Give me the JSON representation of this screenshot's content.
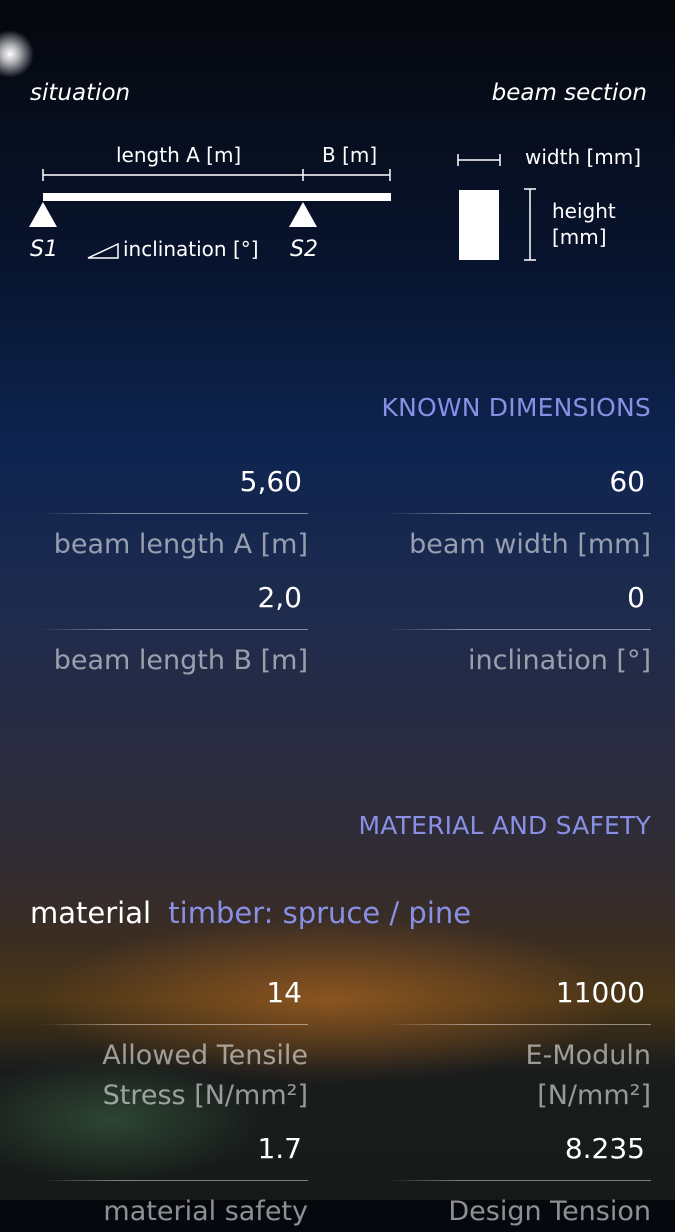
{
  "diagram": {
    "situation_title": "situation",
    "beam_section_title": "beam section",
    "length_a_label": "length A [m]",
    "length_b_label": "B [m]",
    "support_1": "S1",
    "support_2": "S2",
    "inclination_label": "inclination [°]",
    "width_label": "width [mm]",
    "height_label_line1": "height",
    "height_label_line2": "[mm]"
  },
  "known_dimensions": {
    "title": "KNOWN DIMENSIONS",
    "beam_length_a": {
      "value": "5,60",
      "label": "beam length A [m]"
    },
    "beam_width": {
      "value": "60",
      "label": "beam width [mm]"
    },
    "beam_length_b": {
      "value": "2,0",
      "label": "beam length B [m]"
    },
    "inclination": {
      "value": "0",
      "label": "inclination [°]"
    }
  },
  "material_safety": {
    "title": "MATERIAL AND SAFETY",
    "material_label": "material",
    "material_value": "timber: spruce / pine",
    "tensile_stress": {
      "value": "14",
      "label_line1": "Allowed Tensile",
      "label_line2": "Stress [N/mm²]"
    },
    "e_modulus": {
      "value": "11000",
      "label_line1": "E-Moduln",
      "label_line2": "[N/mm²]"
    },
    "material_safety": {
      "value": "1.7",
      "label_line1": "material safety"
    },
    "design_tension": {
      "value": "8.235",
      "label_line1": "Design Tension"
    }
  },
  "colors": {
    "accent": "#8a8fe6",
    "text": "#ffffff",
    "muted_text": "rgba(255,255,255,0.55)"
  }
}
